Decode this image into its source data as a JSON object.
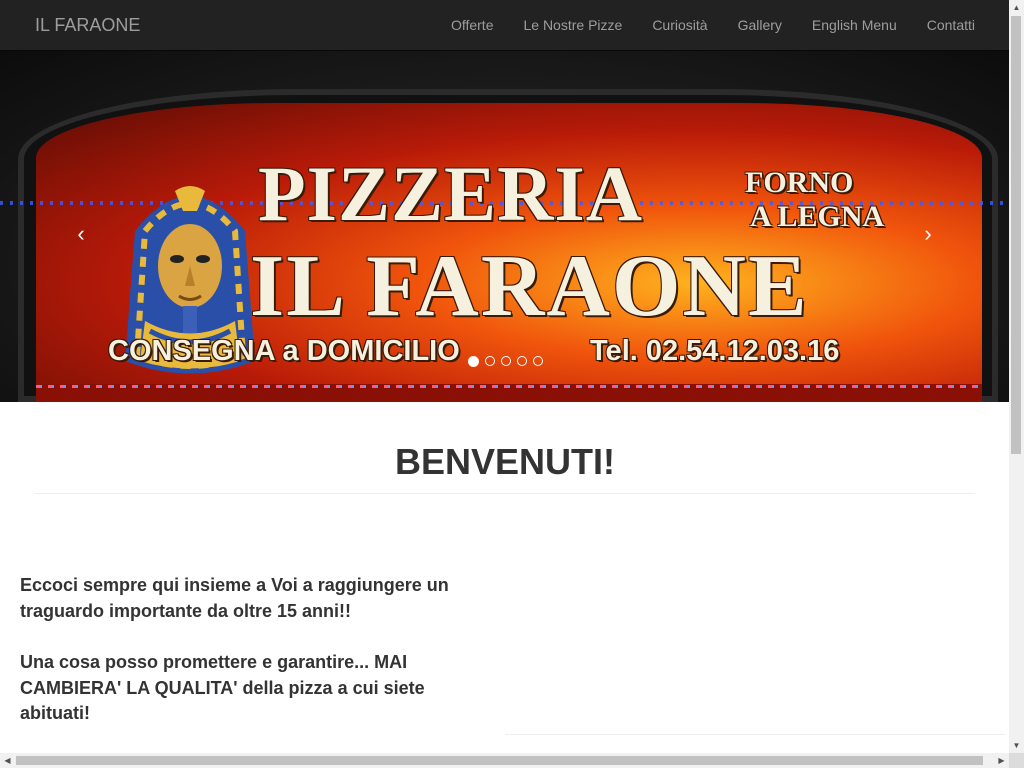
{
  "navbar": {
    "brand": "IL FARAONE",
    "items": [
      {
        "label": "Offerte"
      },
      {
        "label": "Le Nostre Pizze"
      },
      {
        "label": "Curiosità"
      },
      {
        "label": "Gallery"
      },
      {
        "label": "English Menu"
      },
      {
        "label": "Contatti"
      }
    ]
  },
  "carousel": {
    "sign": {
      "line1": "PIZZERIA",
      "line2a": "FORNO",
      "line2b": "A LEGNA",
      "line3": "IL FARAONE",
      "line4a": "CONSEGNA a DOMICILIO",
      "line4b": "Tel. 02.54.12.03.16"
    },
    "prev_icon": "‹",
    "next_icon": "›",
    "indicator_count": 5,
    "active_index": 0
  },
  "main": {
    "heading": "BENVENUTI!",
    "paragraphs": [
      "Eccoci sempre qui insieme a Voi a raggiungere un traguardo importante da oltre 15 anni!!",
      "Una cosa posso promettere e garantire... MAI CAMBIERA' LA QUALITA' della pizza a cui siete abituati!"
    ]
  },
  "scrollbars": {
    "up_icon": "▲",
    "down_icon": "▼",
    "left_icon": "◀",
    "right_icon": "▶"
  }
}
